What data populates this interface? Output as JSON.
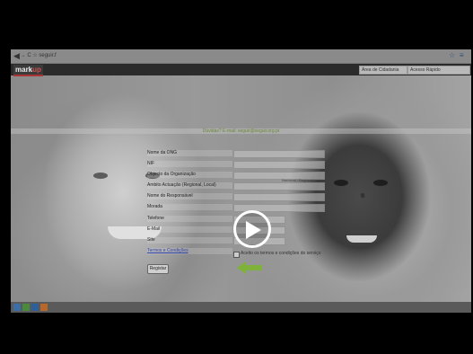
{
  "browser": {
    "url_text": "← → C  ☆  seguir.f",
    "right_icons": [
      "☆",
      "≡"
    ]
  },
  "site": {
    "logo_prefix": "mark",
    "logo_suffix": "up",
    "select1": "Área de Cidadania",
    "select2": "Acesso Rápido"
  },
  "banner": {
    "text": "Dúvidas? E-mail: seguir@seguir.org.pt"
  },
  "form": {
    "labels": [
      "Nome da ONG",
      "NIF",
      "Objecto da Organização",
      "Âmbito Actuação (Regional, Local)",
      "Nome do Responsável",
      "Morada",
      "Telefone",
      "E-Mail",
      "Site",
      "Termos e Condições"
    ],
    "hint": "Nacional / Regional",
    "checkbox_label": "Aceito os termos e condições do serviço",
    "register_button": "Registar"
  },
  "video": {
    "play_label": "Play"
  },
  "colors": {
    "accent_link": "#3344aa",
    "logo_accent": "#d05050",
    "banner_text": "#6b8a3a",
    "arrow_green": "#7fb23a"
  }
}
